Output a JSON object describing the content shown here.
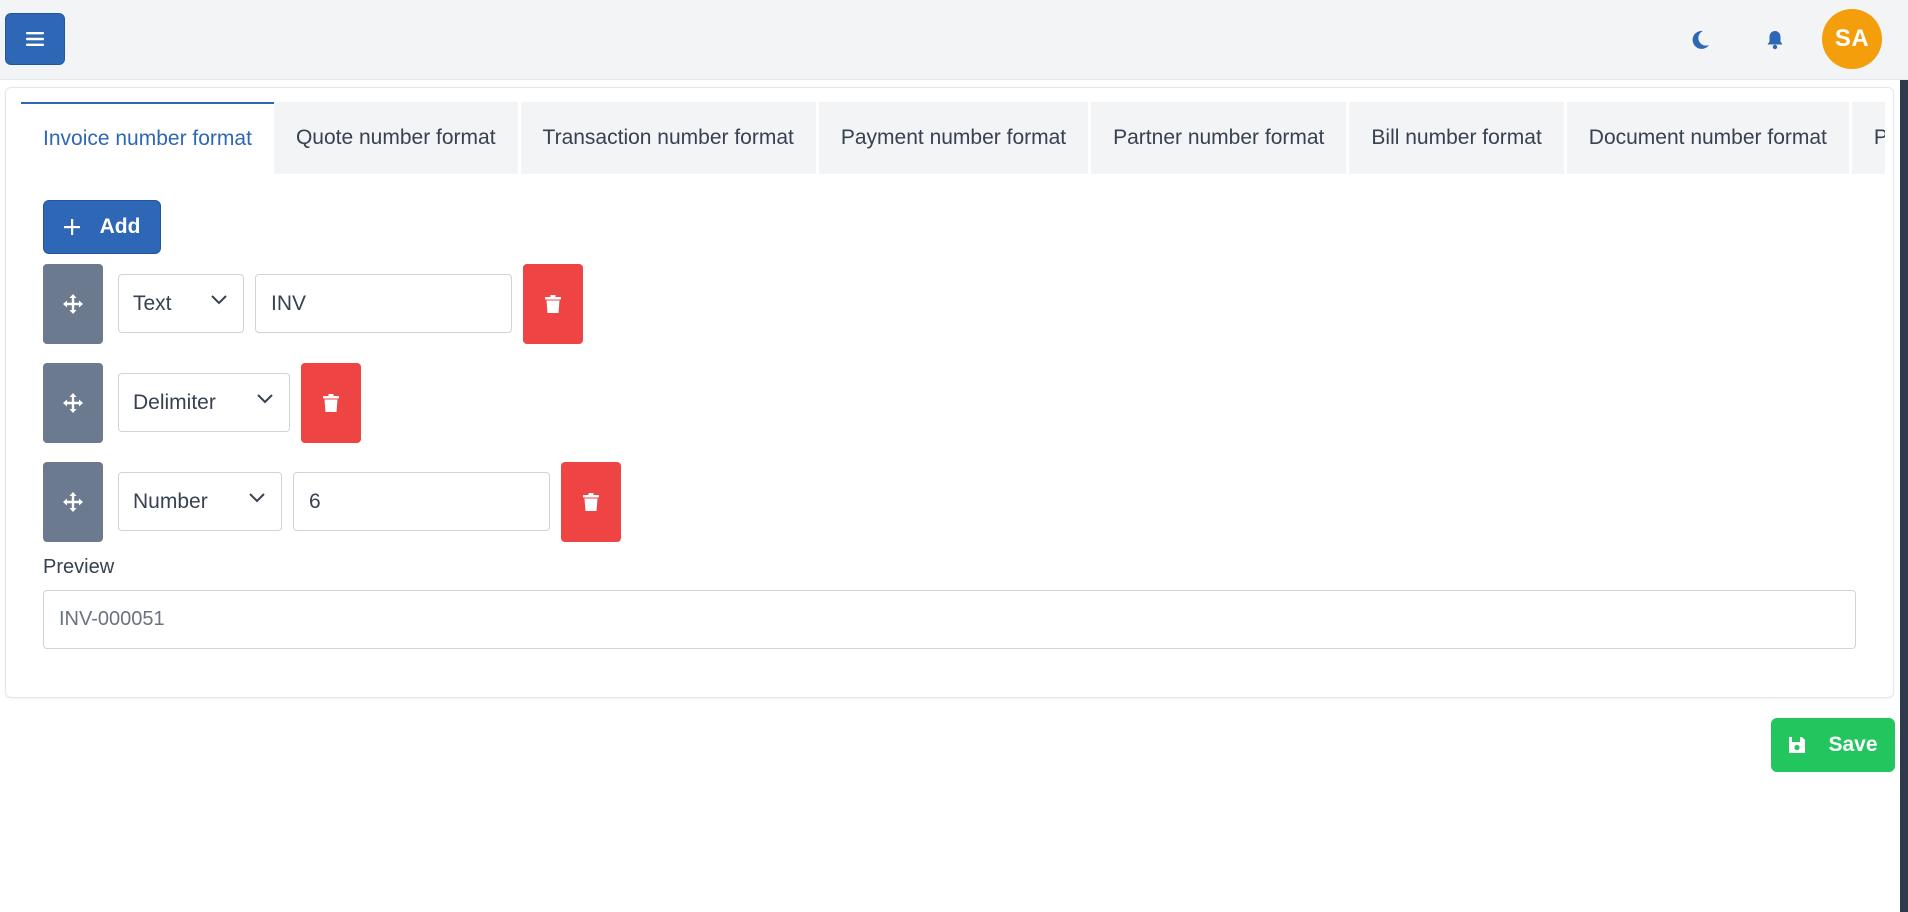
{
  "header": {
    "menu_icon": "hamburger-icon",
    "theme_icon": "moon-icon",
    "notification_icon": "bell-icon",
    "avatar_initials": "SA"
  },
  "tabs": [
    {
      "label": "Invoice number format",
      "active": true
    },
    {
      "label": "Quote number format",
      "active": false
    },
    {
      "label": "Transaction number format",
      "active": false
    },
    {
      "label": "Payment number format",
      "active": false
    },
    {
      "label": "Partner number format",
      "active": false
    },
    {
      "label": "Bill number format",
      "active": false
    },
    {
      "label": "Document number format",
      "active": false
    },
    {
      "label": "Product",
      "active": false
    }
  ],
  "add_button": {
    "label": "Add",
    "icon": "plus-icon"
  },
  "format_rows": [
    {
      "type": "Text",
      "value": "INV"
    },
    {
      "type": "Delimiter",
      "value": null
    },
    {
      "type": "Number",
      "value": "6"
    }
  ],
  "preview": {
    "label": "Preview",
    "value": "INV-000051"
  },
  "save_button": {
    "label": "Save",
    "icon": "floppy-disk-icon"
  },
  "colors": {
    "primary": "#2f67b7",
    "danger": "#ef4444",
    "success": "#22c55e",
    "avatar": "#f59e0b",
    "drag_handle": "#6b7a8f"
  }
}
